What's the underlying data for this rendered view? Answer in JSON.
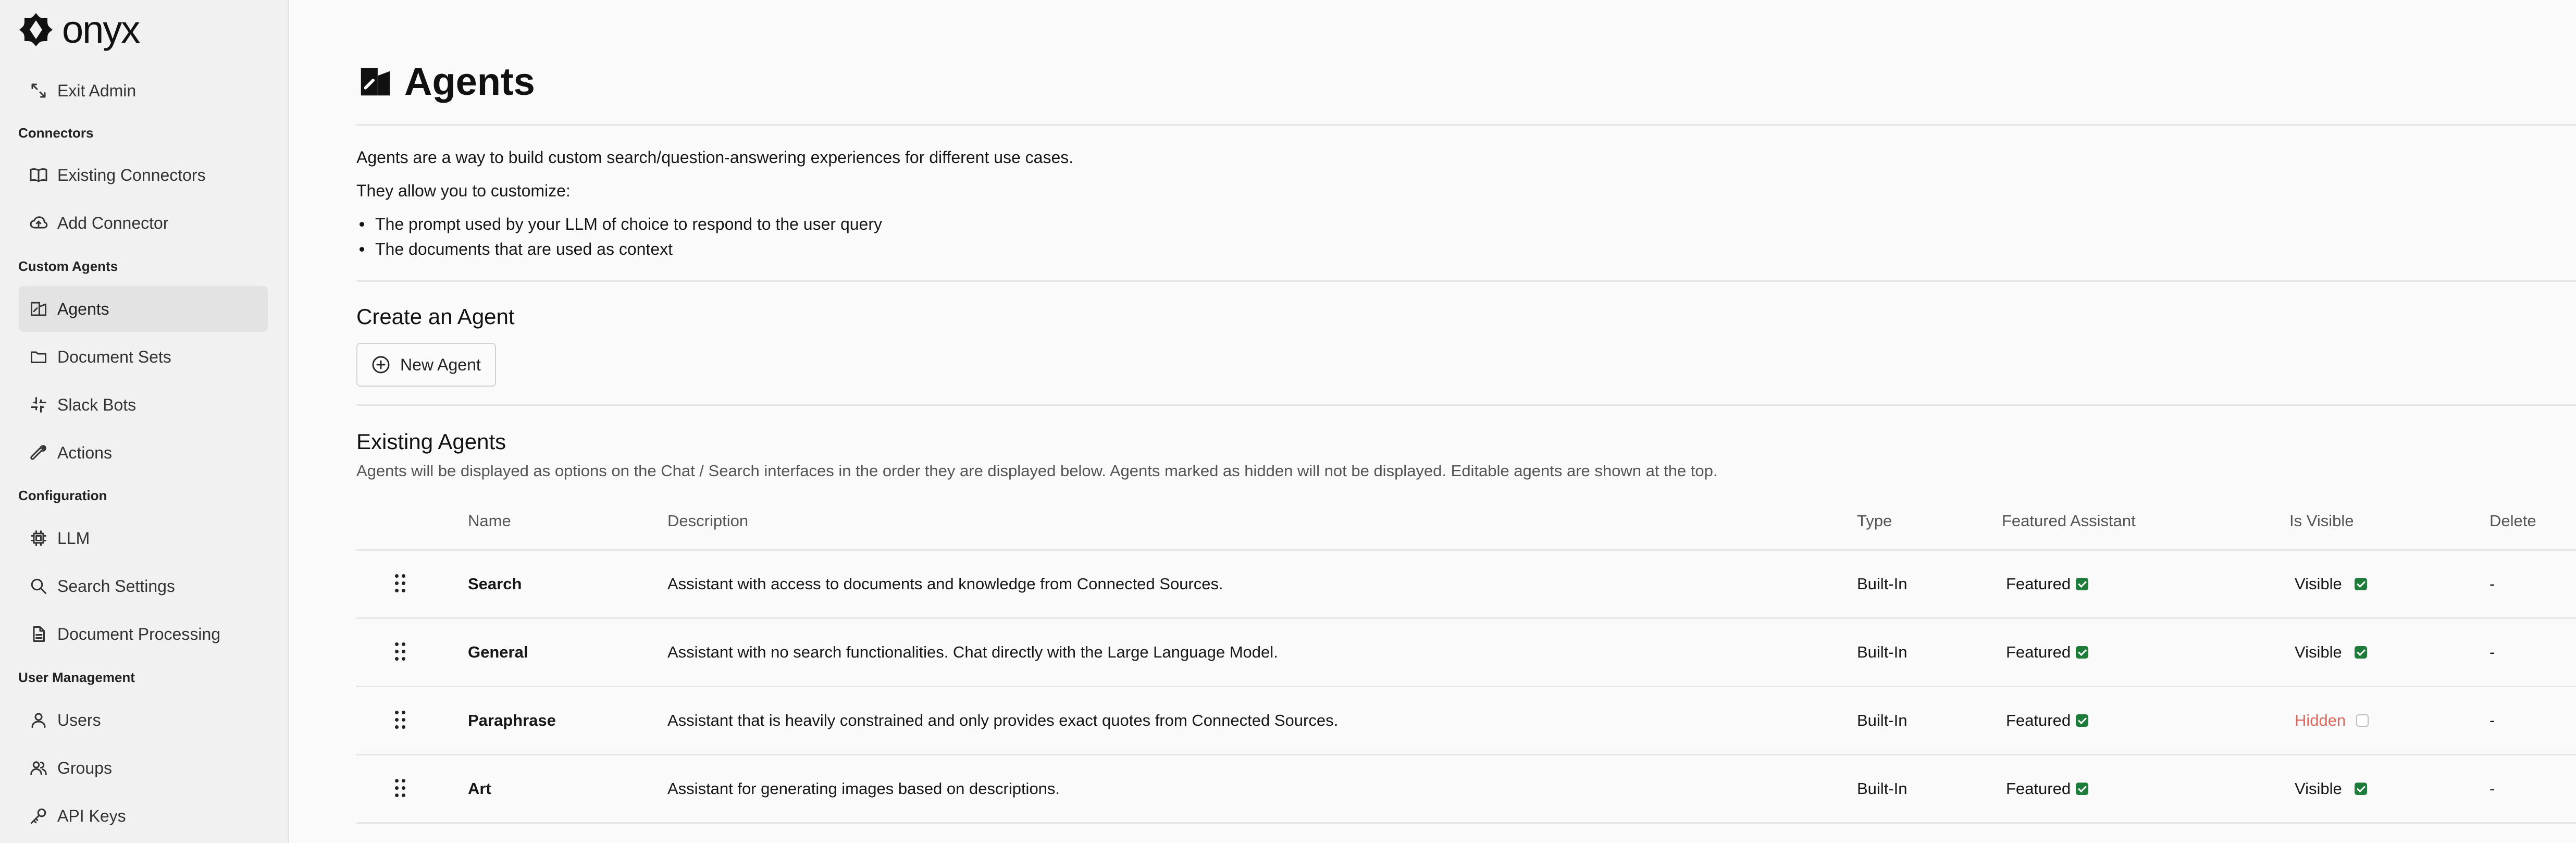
{
  "brand": {
    "name": "onyx"
  },
  "sidebar": {
    "exit_admin": "Exit Admin",
    "sections": {
      "connectors": "Connectors",
      "custom_agents": "Custom Agents",
      "configuration": "Configuration",
      "user_management": "User Management"
    },
    "items": {
      "existing_connectors": "Existing Connectors",
      "add_connector": "Add Connector",
      "agents": "Agents",
      "document_sets": "Document Sets",
      "slack_bots": "Slack Bots",
      "actions": "Actions",
      "llm": "LLM",
      "search_settings": "Search Settings",
      "document_processing": "Document Processing",
      "users": "Users",
      "groups": "Groups",
      "api_keys": "API Keys"
    },
    "active": "agents"
  },
  "page": {
    "title": "Agents",
    "intro1": "Agents are a way to build custom search/question-answering experiences for different use cases.",
    "intro2": "They allow you to customize:",
    "bullets": [
      "The prompt used by your LLM of choice to respond to the user query",
      "The documents that are used as context"
    ],
    "create_title": "Create an Agent",
    "new_agent_label": "New Agent",
    "existing_title": "Existing Agents",
    "existing_desc": "Agents will be displayed as options on the Chat / Search interfaces in the order they are displayed below. Agents marked as hidden will not be displayed. Editable agents are shown at the top."
  },
  "table": {
    "headers": {
      "name": "Name",
      "description": "Description",
      "type": "Type",
      "featured": "Featured Assistant",
      "visible": "Is Visible",
      "delete": "Delete"
    },
    "rows": [
      {
        "name": "Search",
        "description": "Assistant with access to documents and knowledge from Connected Sources.",
        "type": "Built-In",
        "featured": "Featured",
        "visible": "Visible",
        "is_visible": true,
        "delete": "-"
      },
      {
        "name": "General",
        "description": "Assistant with no search functionalities. Chat directly with the Large Language Model.",
        "type": "Built-In",
        "featured": "Featured",
        "visible": "Visible",
        "is_visible": true,
        "delete": "-"
      },
      {
        "name": "Paraphrase",
        "description": "Assistant that is heavily constrained and only provides exact quotes from Connected Sources.",
        "type": "Built-In",
        "featured": "Featured",
        "visible": "Hidden",
        "is_visible": false,
        "delete": "-"
      },
      {
        "name": "Art",
        "description": "Assistant for generating images based on descriptions.",
        "type": "Built-In",
        "featured": "Featured",
        "visible": "Visible",
        "is_visible": true,
        "delete": "-"
      }
    ]
  },
  "colors": {
    "check_green": "#1d7c3a",
    "hidden_red": "#e0655a",
    "sidebar_bg": "#f1f1f1",
    "active_item_bg": "#e3e3e3"
  }
}
